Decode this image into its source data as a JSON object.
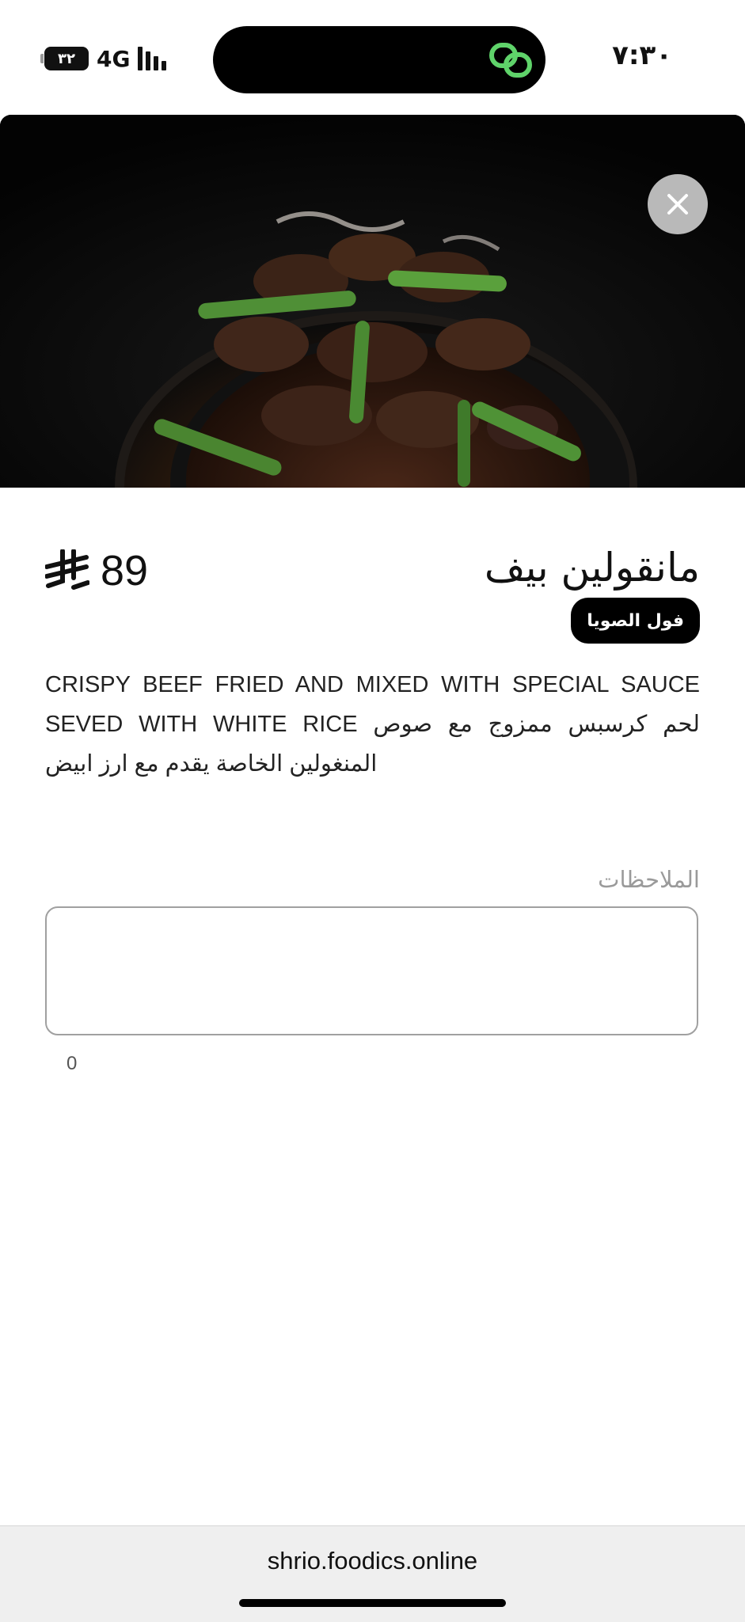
{
  "status_bar": {
    "time": "٧:٣٠",
    "battery": "٣٢",
    "network": "4G"
  },
  "item": {
    "title": "مانقولين بيف",
    "price": "89",
    "currency_icon": "riyal-symbol-icon",
    "tag": "فول الصويا",
    "description": "CRISPY BEEF FRIED AND MIXED WITH SPECIAL SAUCE SEVED WITH WHITE RICE لحم كرسبس ممزوج مع صوص المنغولين الخاصة يقدم مع ارز ابيض"
  },
  "notes": {
    "label": "الملاحظات",
    "value": "",
    "count": "0"
  },
  "browser": {
    "url": "shrio.foodics.online"
  },
  "icons": {
    "close": "close-icon",
    "island_app": "link-icon"
  },
  "colors": {
    "island_icon": "#5fd36a",
    "tag_bg": "#000000",
    "close_bg": "#b9b9b9"
  }
}
